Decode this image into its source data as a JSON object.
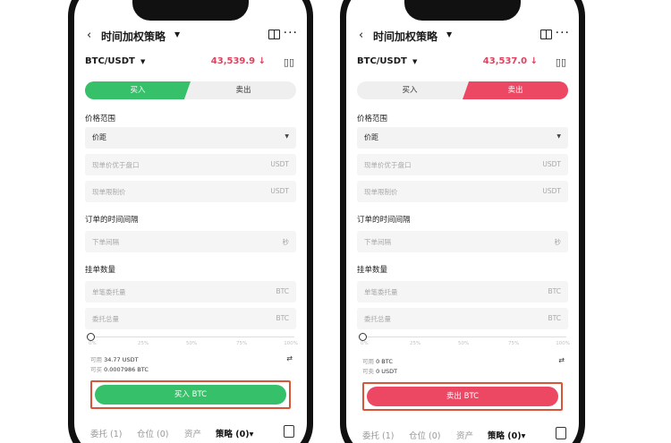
{
  "screens": [
    {
      "nav": {
        "title": "时间加权策略"
      },
      "pair": {
        "symbol": "BTC/USDT",
        "price": "43,539.9 ↓"
      },
      "segment": {
        "buy": "买入",
        "sell": "卖出",
        "active": "buy"
      },
      "price_range": {
        "label": "价格范围",
        "select_value": "价距",
        "limit_placeholder": "现单价优于盘口",
        "limit_unit": "USDT",
        "cap_placeholder": "现单限制价",
        "cap_unit": "USDT"
      },
      "interval": {
        "label": "订单的时间间隔",
        "placeholder": "下单间隔",
        "unit": "秒"
      },
      "quantity": {
        "label": "挂单数量",
        "single_placeholder": "单笔委托量",
        "single_unit": "BTC",
        "total_placeholder": "委托总量",
        "total_unit": "BTC"
      },
      "slider": {
        "ticks": [
          "0%",
          "25%",
          "50%",
          "75%",
          "100%"
        ],
        "value": 0
      },
      "balance": {
        "avail_key": "可用",
        "avail_value": "34.77 USDT",
        "buyable_key": "可买",
        "buyable_value": "0.0007986 BTC"
      },
      "submit": "买入 BTC",
      "bottom_tabs": {
        "orders": "委托 (1)",
        "positions": "仓位 (0)",
        "assets": "资产",
        "strategy": "策略 (0)▾"
      }
    },
    {
      "nav": {
        "title": "时间加权策略"
      },
      "pair": {
        "symbol": "BTC/USDT",
        "price": "43,537.0 ↓"
      },
      "segment": {
        "buy": "买入",
        "sell": "卖出",
        "active": "sell"
      },
      "price_range": {
        "label": "价格范围",
        "select_value": "价距",
        "limit_placeholder": "现单价优于盘口",
        "limit_unit": "USDT",
        "cap_placeholder": "现单限制价",
        "cap_unit": "USDT"
      },
      "interval": {
        "label": "订单的时间间隔",
        "placeholder": "下单间隔",
        "unit": "秒"
      },
      "quantity": {
        "label": "挂单数量",
        "single_placeholder": "单笔委托量",
        "single_unit": "BTC",
        "total_placeholder": "委托总量",
        "total_unit": "BTC"
      },
      "slider": {
        "ticks": [
          "0%",
          "25%",
          "50%",
          "75%",
          "100%"
        ],
        "value": 0
      },
      "balance": {
        "avail_key": "可用",
        "avail_value": "0 BTC",
        "buyable_key": "可卖",
        "buyable_value": "0 USDT"
      },
      "submit": "卖出 BTC",
      "bottom_tabs": {
        "orders": "委托 (1)",
        "positions": "仓位 (0)",
        "assets": "资产",
        "strategy": "策略 (0)▾"
      }
    }
  ],
  "colors": {
    "buy": "#37c06a",
    "sell": "#ec4763",
    "price": "#e0415f",
    "highlight": "#d9553a"
  },
  "icons": [
    "back-arrow-icon",
    "caret-down-icon",
    "book-icon",
    "more-icon",
    "kline-icon",
    "swap-icon",
    "document-icon"
  ]
}
